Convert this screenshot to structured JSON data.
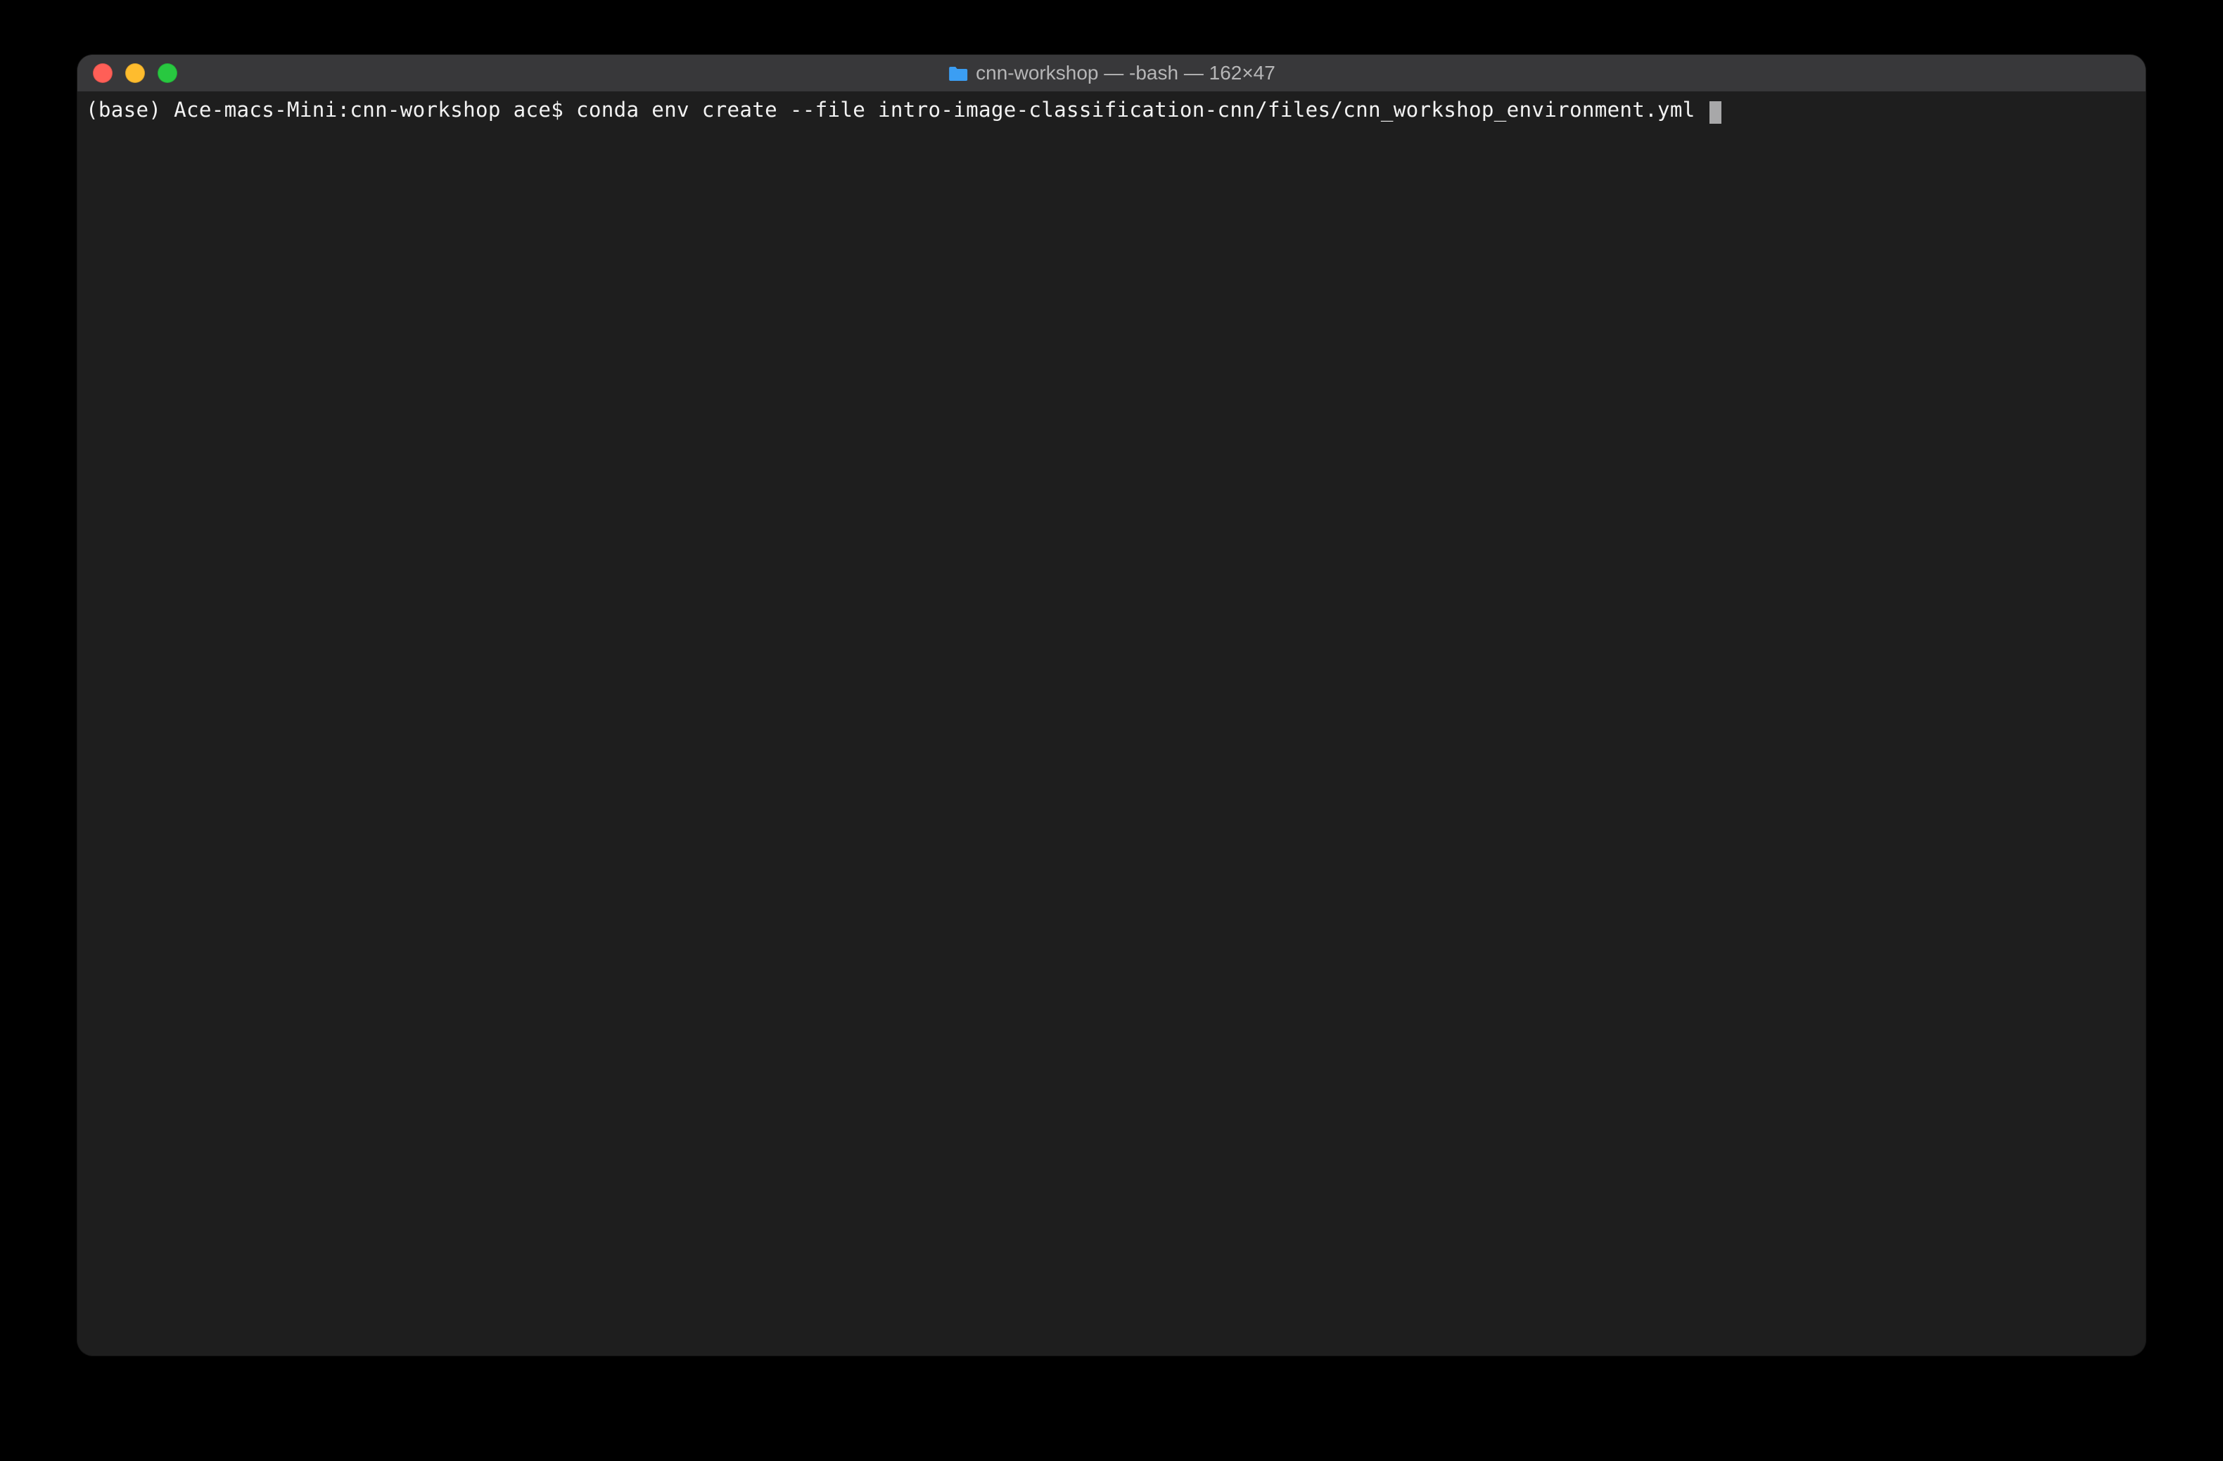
{
  "window": {
    "title": "cnn-workshop — -bash — 162×47",
    "traffic_lights": {
      "close_color": "#ff5f57",
      "minimize_color": "#febc2e",
      "maximize_color": "#28c840"
    }
  },
  "terminal": {
    "prompt": "(base) Ace-macs-Mini:cnn-workshop ace$ ",
    "command": "conda env create --file intro-image-classification-cnn/files/cnn_workshop_environment.yml "
  }
}
